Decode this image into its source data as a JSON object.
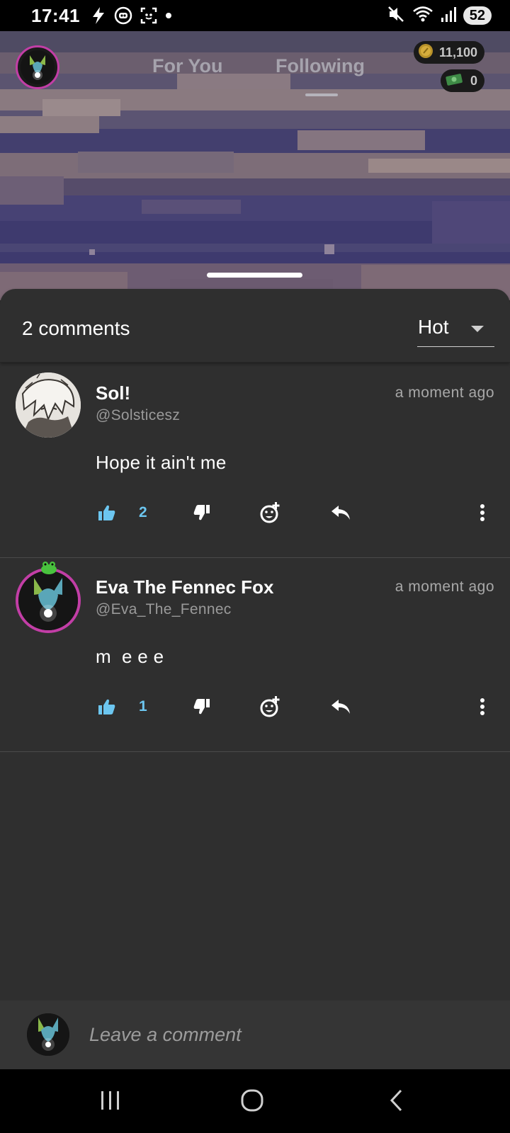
{
  "status_bar": {
    "time": "17:41",
    "battery": "52",
    "left_icons": [
      "lightning-icon",
      "bixby-icon",
      "screen-capture-icon",
      "dot-icon"
    ],
    "right_icons": [
      "mute-icon",
      "wifi-icon",
      "signal-icon"
    ]
  },
  "header": {
    "tabs": [
      {
        "label": "For You",
        "active": false
      },
      {
        "label": "Following",
        "active": true
      }
    ],
    "coins": "11,100",
    "cash": "0"
  },
  "comments_sheet": {
    "count_label": "2 comments",
    "sort": {
      "selected": "Hot"
    },
    "comments": [
      {
        "name": "Sol!",
        "handle": "@Solsticesz",
        "time": "a moment ago",
        "text": "Hope it ain't me",
        "likes": "2"
      },
      {
        "name": "Eva The Fennec Fox",
        "handle": "@Eva_The_Fennec",
        "time": "a moment ago",
        "text": "m  e e e",
        "likes": "1"
      }
    ]
  },
  "input": {
    "placeholder": "Leave a comment"
  },
  "colors": {
    "sheet_bg": "#2f2f2f",
    "like_blue": "#6cc6f0",
    "avatar_ring": "#c23ea6"
  }
}
